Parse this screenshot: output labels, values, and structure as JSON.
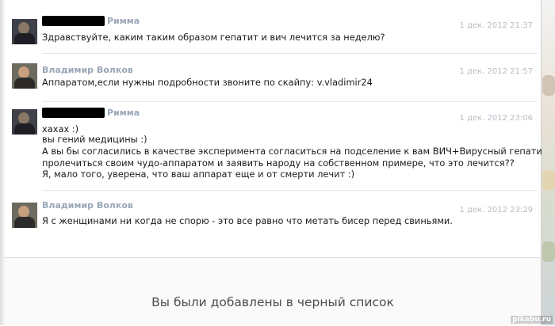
{
  "messages": [
    {
      "author": "Римма",
      "author_redacted": true,
      "date": "1 дек. 2012 21:37",
      "lines": [
        "Здравствуйте, каким таким образом гепатит и вич лечится за неделю?"
      ]
    },
    {
      "author": "Владимир Волков",
      "author_redacted": false,
      "date": "1 дек. 2012 21:57",
      "lines": [
        "Аппаратом,если нужны подробности звоните по скайпу: v.vladimir24"
      ]
    },
    {
      "author": "Римма",
      "author_redacted": true,
      "date": "1 дек. 2012 23:06",
      "lines": [
        "хахах :)",
        "вы гений медицины :)",
        "А вы бы согласились в качестве эксперимента согласиться на подселение к вам ВИЧ+Вирусный гепатитС, и",
        "пролечиться своим чудо-аппаратом и заявить народу на собственном примере, что это лечится??",
        "Я, мало того, уверена, что ваш аппарат еще и от смерти лечит :)"
      ]
    },
    {
      "author": "Владимир Волков",
      "author_redacted": false,
      "date": "1 дек. 2012 23:29",
      "lines": [
        "Я с женщинами ни когда не спорю - это все равно что метать бисер перед свиньями."
      ]
    }
  ],
  "footer": {
    "blacklist_text": "Вы были добавлены в черный список"
  },
  "watermark": "pikabu.ru",
  "colors": {
    "author": "#9aa7b8",
    "date": "#b7bcc3",
    "text": "#1a1a1a",
    "separator": "#e4e7ea"
  }
}
